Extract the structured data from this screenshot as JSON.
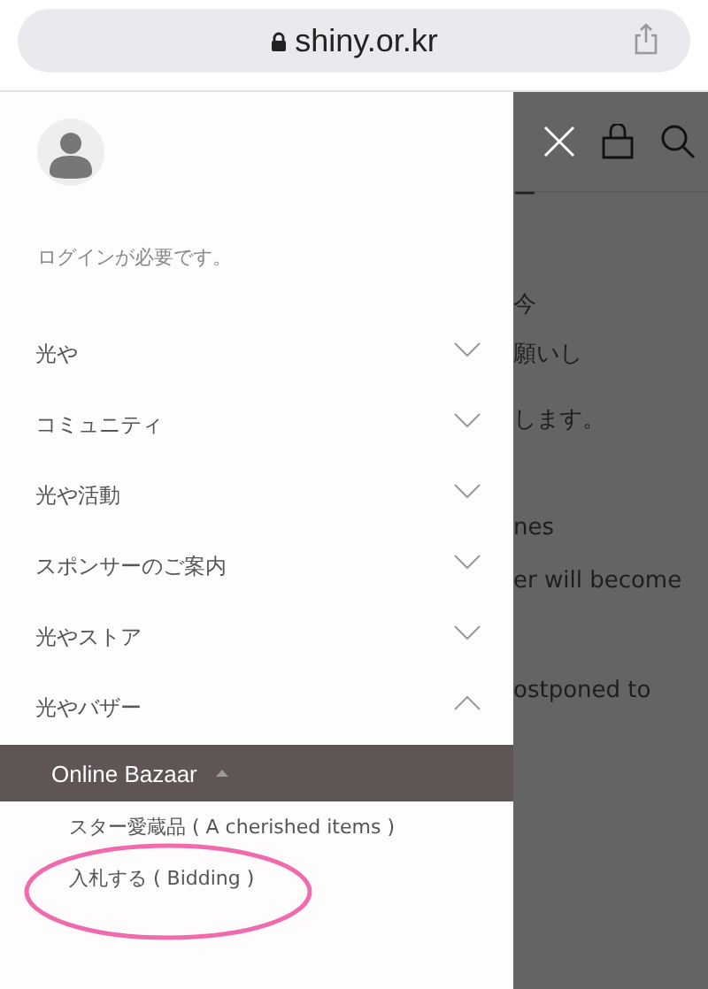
{
  "address_bar": {
    "url": "shiny.or.kr"
  },
  "drawer": {
    "login_prompt": "ログインが必要です。",
    "menu": [
      {
        "label": "光や",
        "expanded": false
      },
      {
        "label": "コミュニティ",
        "expanded": false
      },
      {
        "label": "光や活動",
        "expanded": false
      },
      {
        "label": "スポンサーのご案内",
        "expanded": false
      },
      {
        "label": "光やストア",
        "expanded": false
      },
      {
        "label": "光やバザー",
        "expanded": true,
        "children": [
          {
            "label": "Online Bazaar",
            "selected": true,
            "children": [
              {
                "label": "スター愛蔵品 ( A cherished items )"
              },
              {
                "label": "入札する ( Bidding )"
              }
            ]
          }
        ]
      }
    ]
  },
  "background_page": {
    "text_fragments": [
      "ー",
      "今",
      "願いし",
      "します。",
      "nes",
      "er will become",
      "ostponed to"
    ]
  }
}
